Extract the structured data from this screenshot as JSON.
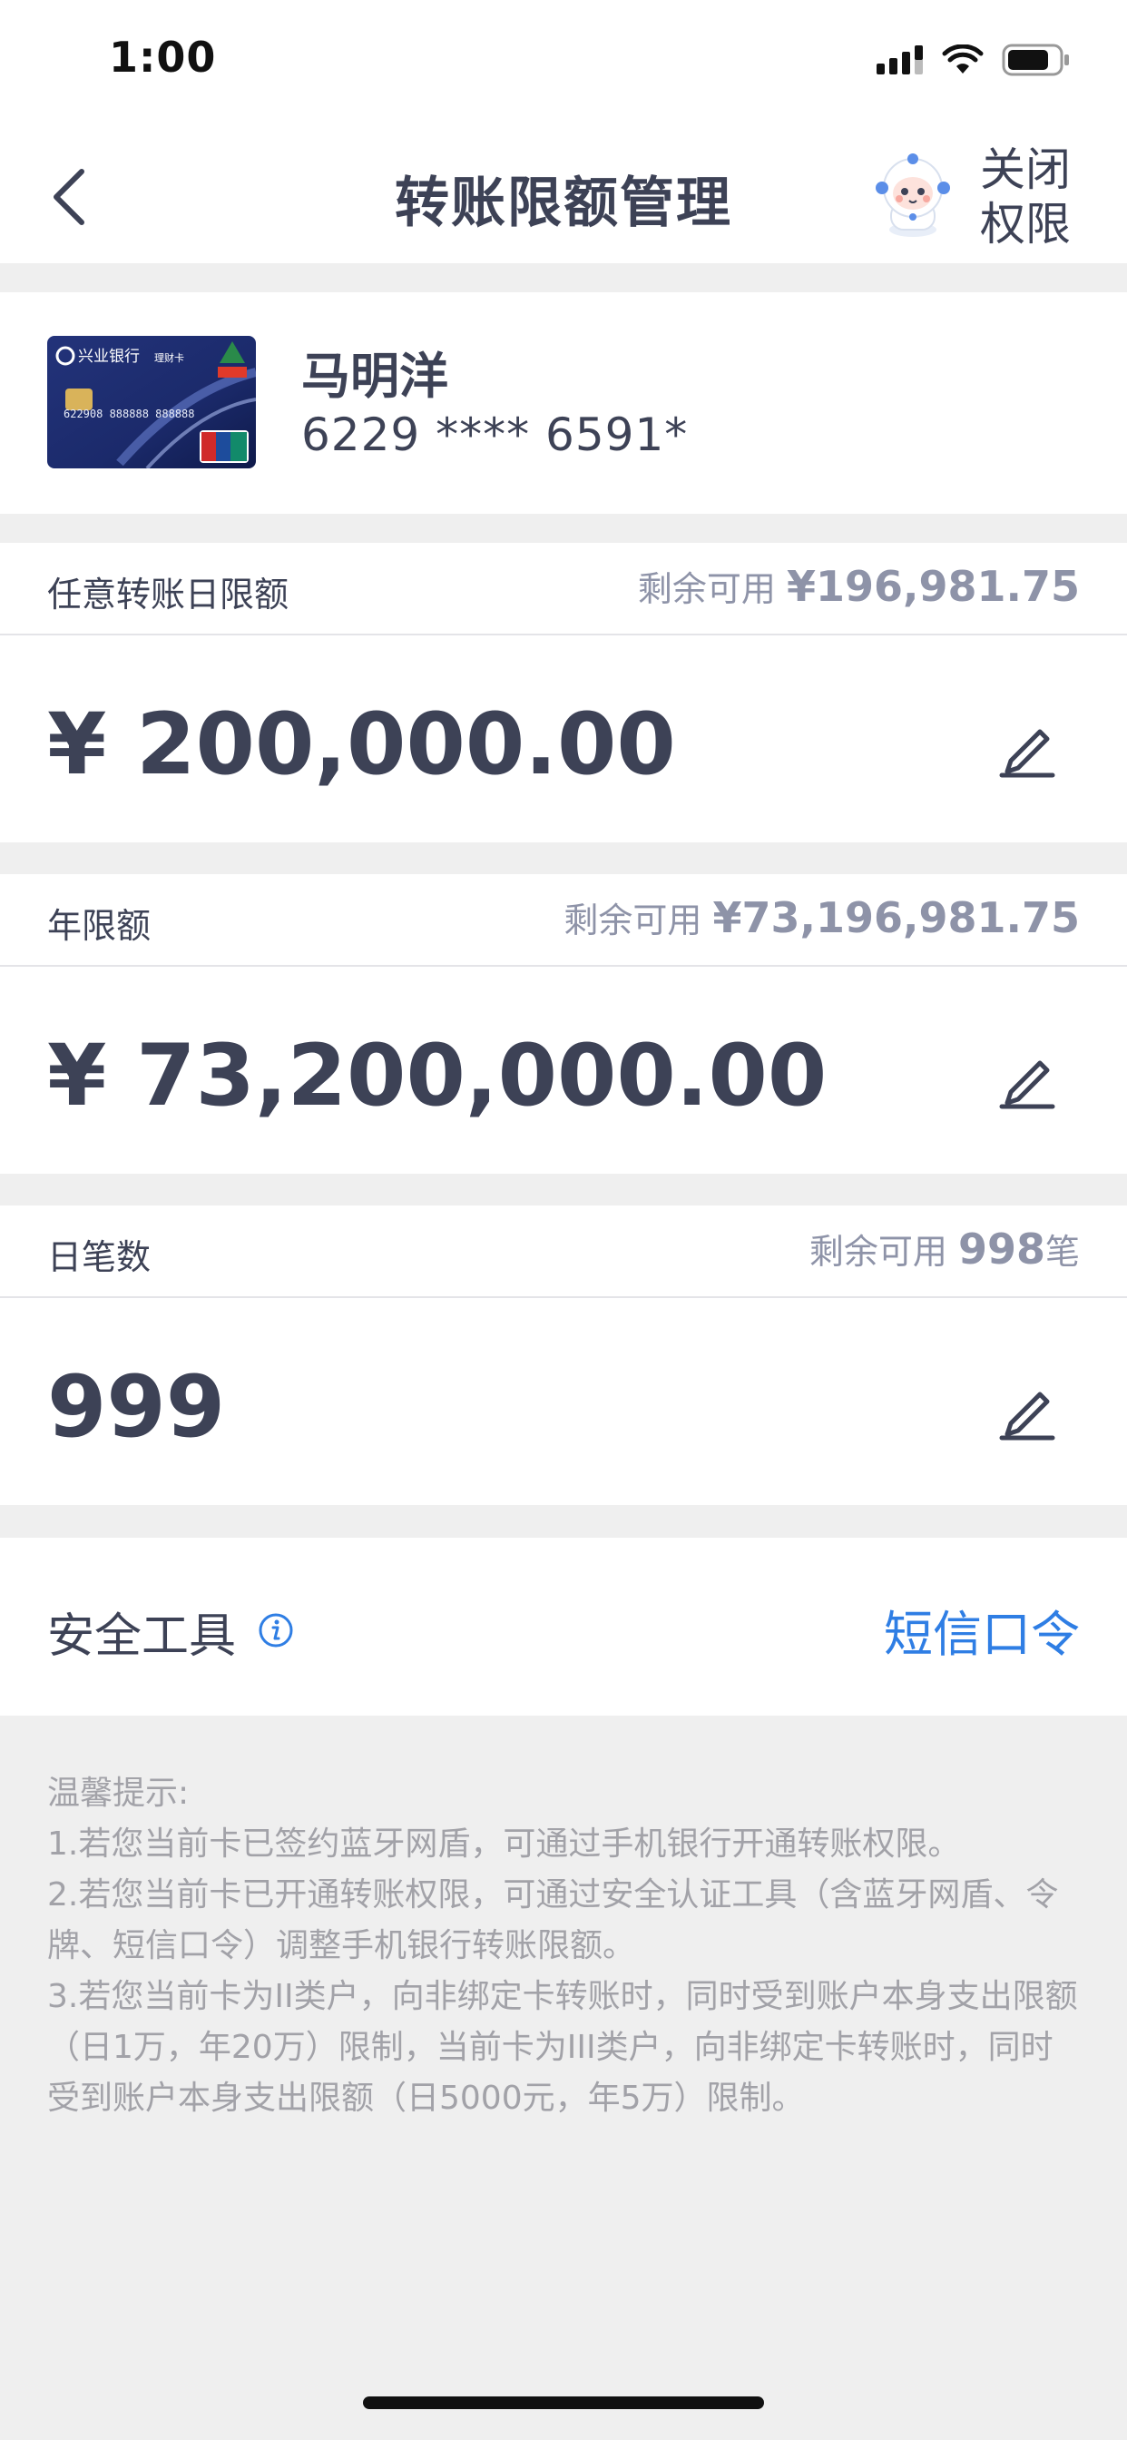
{
  "status_bar": {
    "time": "1:00"
  },
  "nav": {
    "title": "转账限额管理",
    "close_permission": "关闭权限"
  },
  "card": {
    "holder_name": "马明洋",
    "number": "6229 **** 6591*",
    "bank_name": "兴业银行",
    "card_type": "理财卡",
    "card_digits": "622908 888888 888888",
    "union_pay": "UnionPay 银联"
  },
  "limits": [
    {
      "label": "任意转账日限额",
      "remaining_prefix": "剩余可用 ",
      "remaining_amount": "¥196,981.75",
      "remaining_suffix": "",
      "value": "¥ 200,000.00"
    },
    {
      "label": "年限额",
      "remaining_prefix": "剩余可用 ",
      "remaining_amount": "¥73,196,981.75",
      "remaining_suffix": "",
      "value": "¥ 73,200,000.00"
    },
    {
      "label": "日笔数",
      "remaining_prefix": "剩余可用 ",
      "remaining_amount": "998",
      "remaining_suffix": "笔",
      "value": "999"
    }
  ],
  "security": {
    "label": "安全工具",
    "method": "短信口令"
  },
  "tips": {
    "title": "温馨提示:",
    "items": [
      "1.若您当前卡已签约蓝牙网盾，可通过手机银行开通转账权限。",
      "2.若您当前卡已开通转账权限，可通过安全认证工具（含蓝牙网盾、令牌、短信口令）调整手机银行转账限额。",
      "3.若您当前卡为II类户，向非绑定卡转账时，同时受到账户本身支出限额（日1万，年20万）限制，当前卡为III类户，向非绑定卡转账时，同时受到账户本身支出限额（日5000元，年5万）限制。"
    ]
  },
  "colors": {
    "text_primary": "#3d4256",
    "text_secondary": "#8e93a8",
    "link": "#2f7ee4",
    "background": "#efefef"
  }
}
